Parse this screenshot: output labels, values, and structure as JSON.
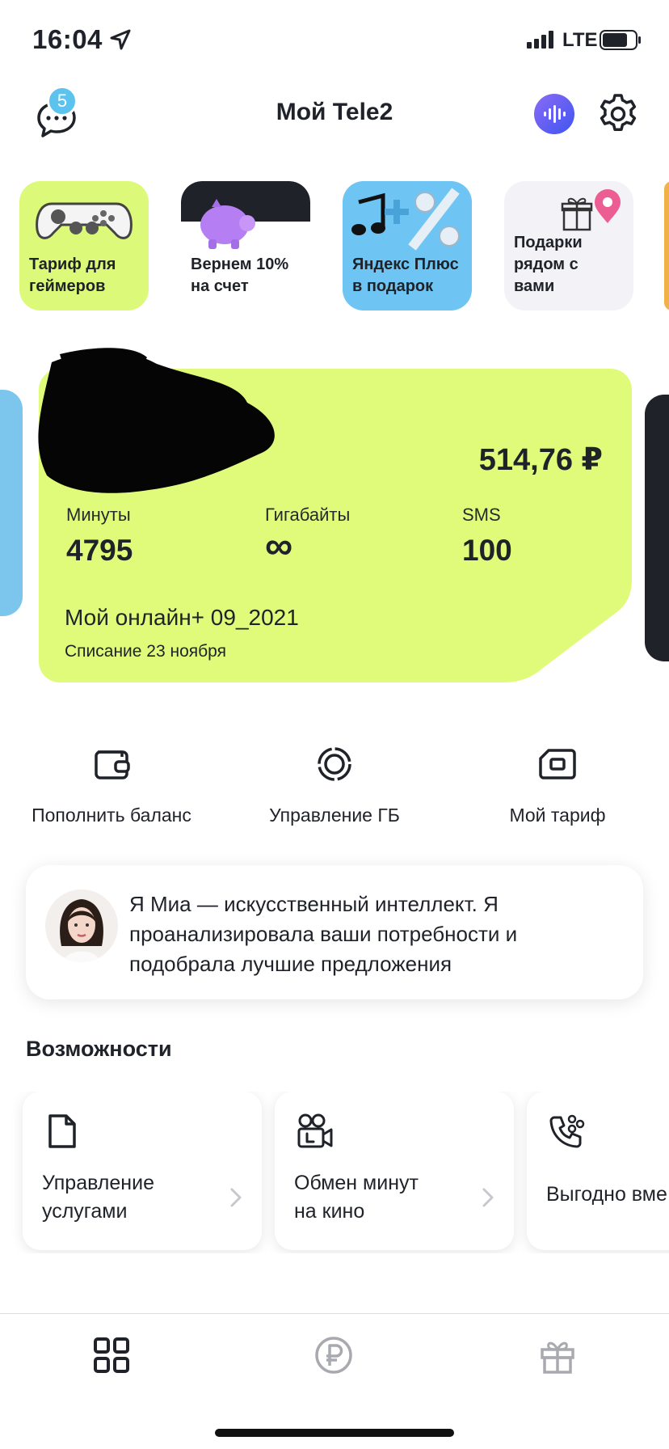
{
  "status_bar": {
    "time": "16:04",
    "network": "LTE"
  },
  "header": {
    "title": "Мой Tele2",
    "chat_badge": "5"
  },
  "stories": [
    {
      "label": "Тариф для\nгеймеров",
      "color": "#ddf97a"
    },
    {
      "label": "Вернем 10%\nна счет",
      "color": "#ffffff"
    },
    {
      "label": "Яндекс Плюс\nв подарок",
      "color": "#6ec5f4"
    },
    {
      "label": "Подарки\nрядом с\nвами",
      "color": "#f2f2f7"
    }
  ],
  "balance_card": {
    "amount": "514,76 ₽",
    "minutes_label": "Минуты",
    "minutes_value": "4795",
    "gb_label": "Гигабайты",
    "gb_value": "∞",
    "sms_label": "SMS",
    "sms_value": "100",
    "plan_name": "Мой онлайн+ 09_2021",
    "charge_date": "Списание 23 ноября",
    "color": "#e0fb7a"
  },
  "actions": [
    {
      "label": "Пополнить баланс",
      "icon": "wallet-icon"
    },
    {
      "label": "Управление ГБ",
      "icon": "data-ring-icon"
    },
    {
      "label": "Мой тариф",
      "icon": "sim-card-icon"
    }
  ],
  "mia": {
    "text": "Я Миа — искусственный интеллект. Я проанализировала ваши потребности и подобрала лучшие предложения"
  },
  "opportunities": {
    "title": "Возможности",
    "items": [
      {
        "label": "Управление\nуслугами",
        "icon": "document-icon"
      },
      {
        "label": "Обмен минут\nна кино",
        "icon": "movie-camera-icon"
      },
      {
        "label": "Выгодно вме",
        "icon": "phone-share-icon"
      }
    ]
  },
  "tabbar": {
    "items": [
      {
        "icon": "grid-icon",
        "active": true
      },
      {
        "icon": "ruble-icon",
        "active": false
      },
      {
        "icon": "gift-icon",
        "active": false
      }
    ]
  }
}
